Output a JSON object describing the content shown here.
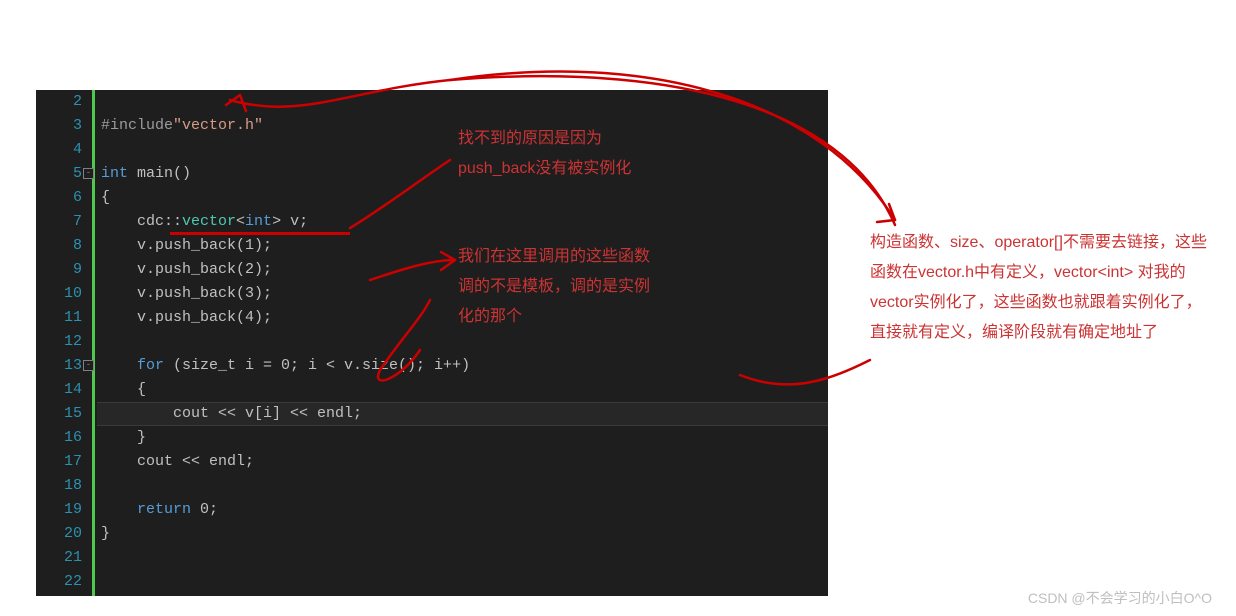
{
  "gutter": [
    "2",
    "3",
    "4",
    "5",
    "6",
    "7",
    "8",
    "9",
    "10",
    "11",
    "12",
    "13",
    "14",
    "15",
    "16",
    "17",
    "18",
    "19",
    "20",
    "21",
    "22"
  ],
  "code": {
    "l3_pp": "#include",
    "l3_str": "\"vector.h\"",
    "l5_kw": "int",
    "l5_fn": " main()",
    "l6": "{",
    "l7_ns": "    cdc::",
    "l7_cls": "vector",
    "l7_tpl": "<",
    "l7_int": "int",
    "l7_close": "> v;",
    "l8": "    v.push_back(1);",
    "l9": "    v.push_back(2);",
    "l10": "    v.push_back(3);",
    "l11": "    v.push_back(4);",
    "l13_for": "    for",
    "l13_rest": " (size_t i = 0; i < v.size(); i++)",
    "l14": "    {",
    "l15": "        cout << v[i] << endl;",
    "l16": "    }",
    "l17": "    cout << endl;",
    "l19_ret": "    return",
    "l19_rest": " 0;",
    "l20": "}"
  },
  "annotations": {
    "mid1": "找不到的原因是因为push_back没有被实例化",
    "mid2": "我们在这里调用的这些函数调的不是模板，调的是实例化的那个",
    "right": "构造函数、size、operator[]不需要去链接，这些函数在vector.h中有定义，vector<int> 对我的vector实例化了，这些函数也就跟着实例化了，直接就有定义，编译阶段就有确定地址了"
  },
  "watermark": "CSDN @不会学习的小白O^O"
}
